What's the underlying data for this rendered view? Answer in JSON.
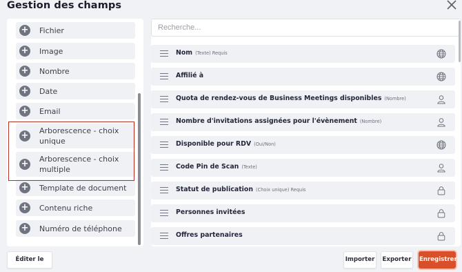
{
  "header": {
    "title": "Gestion des champs"
  },
  "left_panel": {
    "items": [
      {
        "label": "Fichier"
      },
      {
        "label": "Image"
      },
      {
        "label": "Nombre"
      },
      {
        "label": "Date"
      },
      {
        "label": "Email"
      },
      {
        "label": "Arborescence - choix unique"
      },
      {
        "label": "Arborescence - choix multiple"
      },
      {
        "label": "Template de document"
      },
      {
        "label": "Contenu riche"
      },
      {
        "label": "Numéro de téléphone"
      }
    ],
    "add_icon": "plus-circle-icon"
  },
  "search": {
    "placeholder": "Recherche..."
  },
  "fields": [
    {
      "name": "Nom",
      "meta": "(Texte) Requis",
      "icon": "globe-icon"
    },
    {
      "name": "Affilié à",
      "meta": "",
      "icon": "globe-icon"
    },
    {
      "name": "Quota de rendez-vous de Business Meetings disponibles",
      "meta": "(Nombre)",
      "icon": "person-icon"
    },
    {
      "name": "Nombre d'invitations assignées pour l'évènement",
      "meta": "(Nombre)",
      "icon": "person-icon"
    },
    {
      "name": "Disponible pour RDV",
      "meta": "(Oui/Non)",
      "icon": "globe-icon"
    },
    {
      "name": "Code Pin de Scan",
      "meta": "(Texte)",
      "icon": "person-icon"
    },
    {
      "name": "Statut de publication",
      "meta": "(Choix unique) Requis",
      "icon": "lock-icon"
    },
    {
      "name": "Personnes invitées",
      "meta": "",
      "icon": "lock-icon"
    },
    {
      "name": "Offres partenaires",
      "meta": "",
      "icon": "lock-icon"
    }
  ],
  "footer": {
    "edit_json": "Éditer le JSON",
    "import": "Importer",
    "export": "Exporter",
    "save": "Enregistrer"
  },
  "colors": {
    "accent": "#d7502b",
    "highlight_box": "#b13224",
    "panel_bg": "#f1f2f5"
  }
}
